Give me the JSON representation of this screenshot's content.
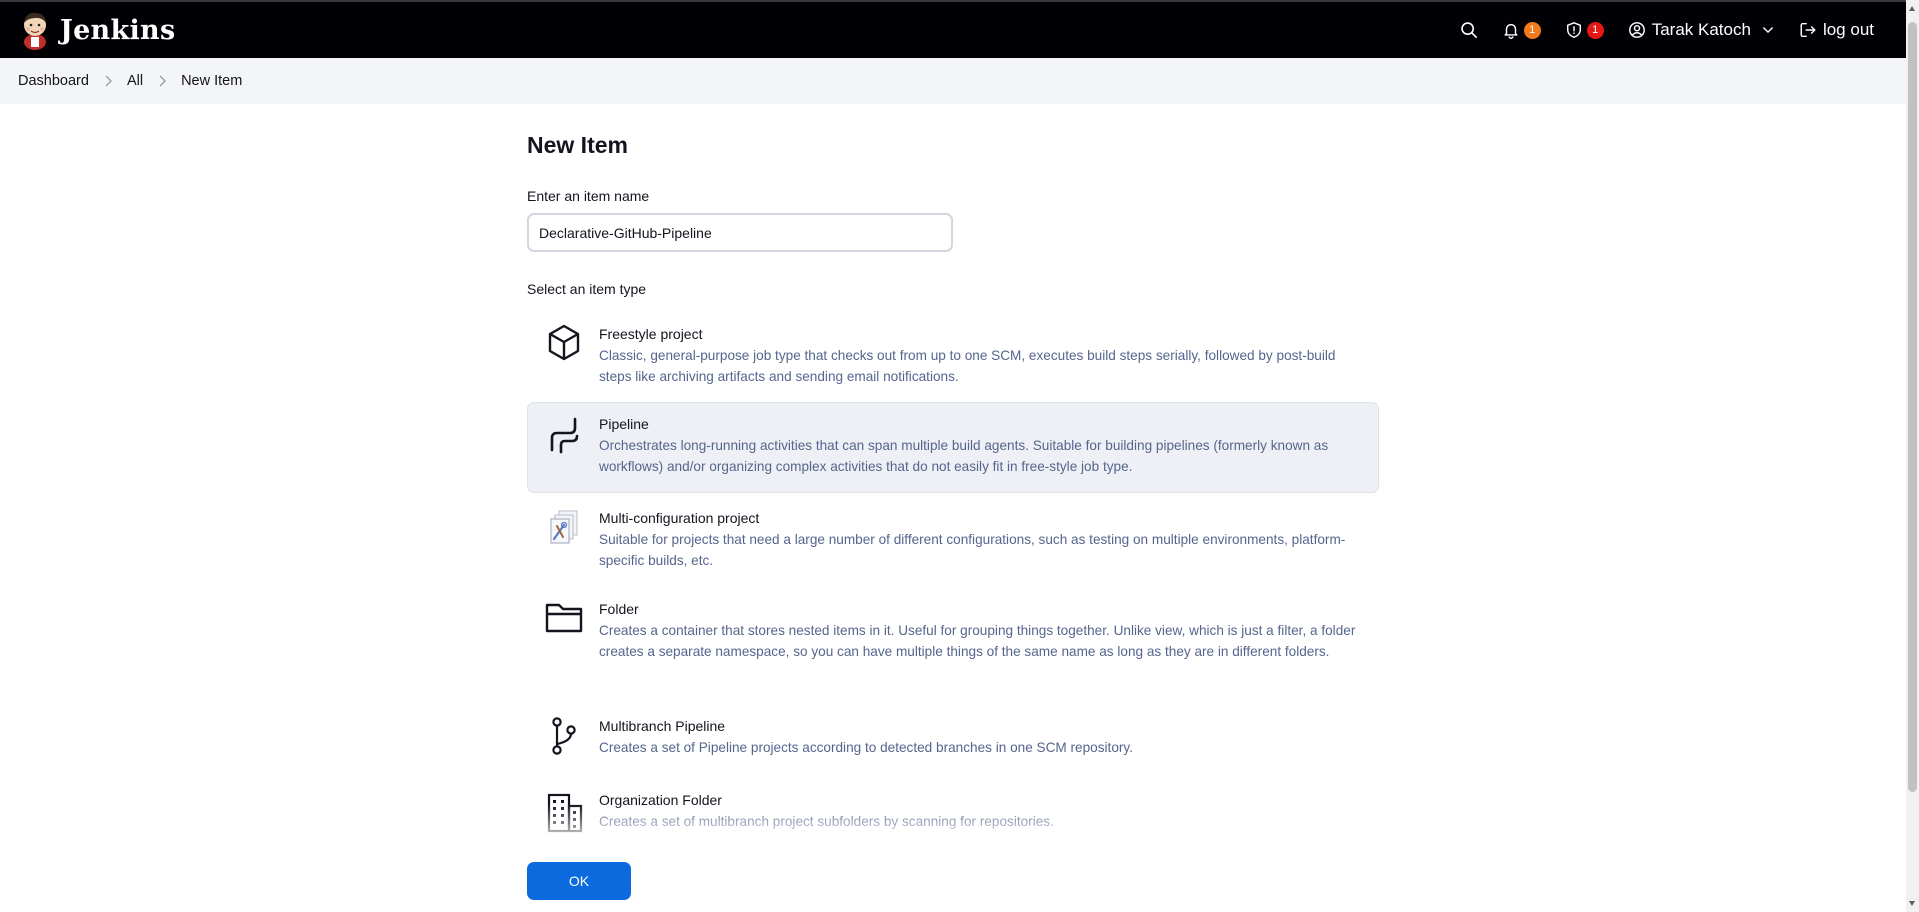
{
  "header": {
    "brand_name": "Jenkins",
    "notifications_count": "1",
    "security_count": "1",
    "user_name": "Tarak Katoch",
    "logout_label": "log out",
    "notification_badge_color": "#f27b1b",
    "security_badge_color": "#e61717"
  },
  "breadcrumb": {
    "items": [
      "Dashboard",
      "All",
      "New Item"
    ]
  },
  "page": {
    "title": "New Item",
    "name_label": "Enter an item name",
    "name_value": "Declarative-GitHub-Pipeline",
    "type_label": "Select an item type"
  },
  "item_types": [
    {
      "title": "Freestyle project",
      "description": "Classic, general-purpose job type that checks out from up to one SCM, executes build steps serially, followed by post-build steps like archiving artifacts and sending email notifications.",
      "icon": "cube-icon",
      "selected": false
    },
    {
      "title": "Pipeline",
      "description": "Orchestrates long-running activities that can span multiple build agents. Suitable for building pipelines (formerly known as workflows) and/or organizing complex activities that do not easily fit in free-style job type.",
      "icon": "pipeline-icon",
      "selected": true
    },
    {
      "title": "Multi-configuration project",
      "description": "Suitable for projects that need a large number of different configurations, such as testing on multiple environments, platform-specific builds, etc.",
      "icon": "multi-config-icon",
      "selected": false
    },
    {
      "title": "Folder",
      "description": "Creates a container that stores nested items in it. Useful for grouping things together. Unlike view, which is just a filter, a folder creates a separate namespace, so you can have multiple things of the same name as long as they are in different folders.",
      "icon": "folder-icon",
      "selected": false
    },
    {
      "title": "Multibranch Pipeline",
      "description": "Creates a set of Pipeline projects according to detected branches in one SCM repository.",
      "icon": "branch-icon",
      "selected": false
    },
    {
      "title": "Organization Folder",
      "description": "Creates a set of multibranch project subfolders by scanning for repositories.",
      "icon": "building-icon",
      "selected": false
    }
  ],
  "footer": {
    "ok_label": "OK",
    "ok_color": "#0b6bde"
  }
}
